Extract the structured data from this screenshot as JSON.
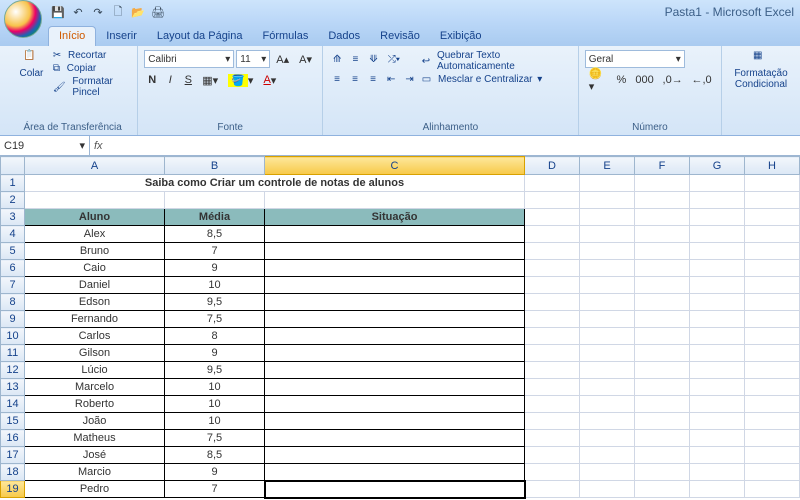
{
  "app": {
    "title": "Pasta1 - Microsoft Excel"
  },
  "qat": {
    "save": "💾",
    "undo": "↶",
    "redo": "↷",
    "new": "🗋",
    "open": "📂",
    "print": "🖨"
  },
  "tabs": {
    "items": [
      "Início",
      "Inserir",
      "Layout da Página",
      "Fórmulas",
      "Dados",
      "Revisão",
      "Exibição"
    ],
    "active": 0
  },
  "ribbon": {
    "clipboard": {
      "label": "Área de Transferência",
      "paste": "Colar",
      "cut": "Recortar",
      "copy": "Copiar",
      "format_painter": "Formatar Pincel"
    },
    "font": {
      "label": "Fonte",
      "family": "Calibri",
      "size": "11",
      "bold": "N",
      "italic": "I",
      "underline": "S"
    },
    "alignment": {
      "label": "Alinhamento",
      "wrap": "Quebrar Texto Automaticamente",
      "merge": "Mesclar e Centralizar"
    },
    "number": {
      "label": "Número",
      "format": "Geral"
    },
    "styles": {
      "cond": "Formatação Condicional"
    }
  },
  "formula_bar": {
    "cell_ref": "C19",
    "fx": "fx",
    "value": ""
  },
  "sheet": {
    "columns": [
      "A",
      "B",
      "C",
      "D",
      "E",
      "F",
      "G",
      "H"
    ],
    "title_row": "Saiba como Criar um controle de notas de alunos",
    "headers": {
      "a": "Aluno",
      "b": "Média",
      "c": "Situação"
    },
    "rows": [
      {
        "n": 4,
        "a": "Alex",
        "b": "8,5"
      },
      {
        "n": 5,
        "a": "Bruno",
        "b": "7"
      },
      {
        "n": 6,
        "a": "Caio",
        "b": "9"
      },
      {
        "n": 7,
        "a": "Daniel",
        "b": "10"
      },
      {
        "n": 8,
        "a": "Edson",
        "b": "9,5"
      },
      {
        "n": 9,
        "a": "Fernando",
        "b": "7,5"
      },
      {
        "n": 10,
        "a": "Carlos",
        "b": "8"
      },
      {
        "n": 11,
        "a": "Gilson",
        "b": "9"
      },
      {
        "n": 12,
        "a": "Lúcio",
        "b": "9,5"
      },
      {
        "n": 13,
        "a": "Marcelo",
        "b": "10"
      },
      {
        "n": 14,
        "a": "Roberto",
        "b": "10"
      },
      {
        "n": 15,
        "a": "João",
        "b": "10"
      },
      {
        "n": 16,
        "a": "Matheus",
        "b": "7,5"
      },
      {
        "n": 17,
        "a": "José",
        "b": "8,5"
      },
      {
        "n": 18,
        "a": "Marcio",
        "b": "9"
      },
      {
        "n": 19,
        "a": "Pedro",
        "b": "7"
      }
    ],
    "active_cell": "C19"
  }
}
